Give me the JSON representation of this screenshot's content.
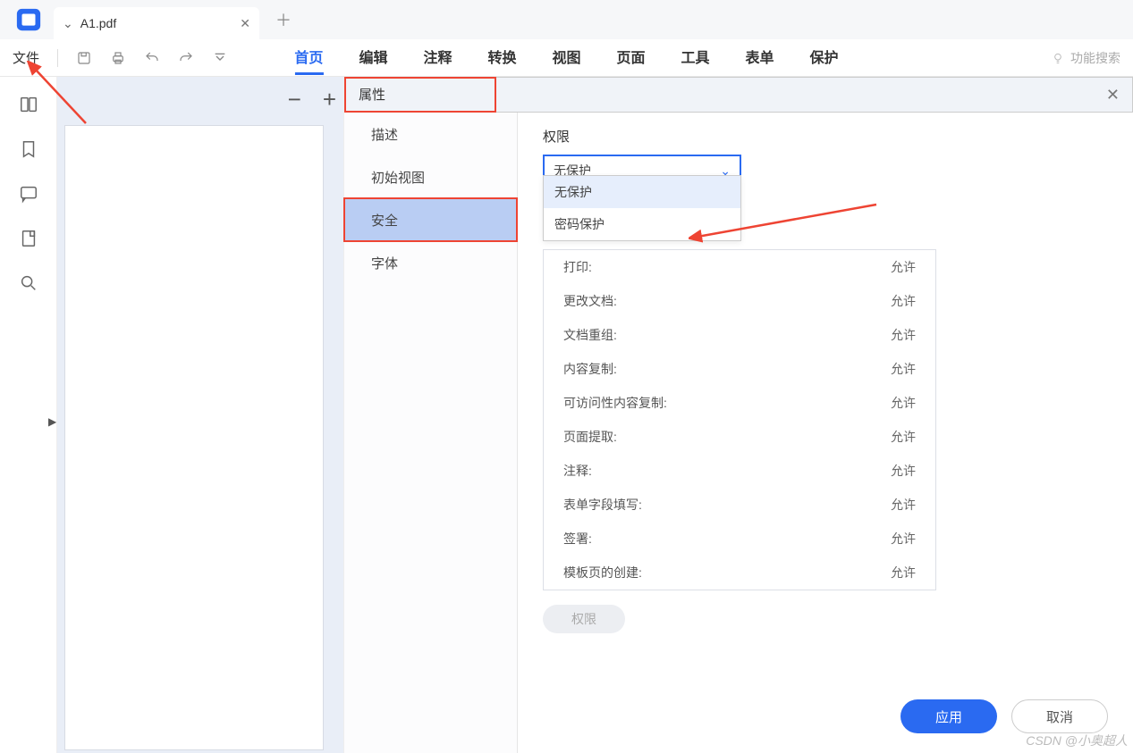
{
  "tab": {
    "filename": "A1.pdf"
  },
  "toolbar": {
    "file": "文件",
    "search_placeholder": "功能搜索"
  },
  "menu": [
    "首页",
    "编辑",
    "注释",
    "转换",
    "视图",
    "页面",
    "工具",
    "表单",
    "保护"
  ],
  "menu_active_index": 0,
  "panel": {
    "title": "属性",
    "nav": [
      "描述",
      "初始视图",
      "安全",
      "字体"
    ],
    "nav_active_index": 2,
    "section_label": "权限",
    "select_value": "无保护",
    "dropdown": [
      "无保护",
      "密码保护"
    ],
    "permissions": [
      {
        "k": "打印:",
        "v": "允许"
      },
      {
        "k": "更改文档:",
        "v": "允许"
      },
      {
        "k": "文档重组:",
        "v": "允许"
      },
      {
        "k": "内容复制:",
        "v": "允许"
      },
      {
        "k": "可访问性内容复制:",
        "v": "允许"
      },
      {
        "k": "页面提取:",
        "v": "允许"
      },
      {
        "k": "注释:",
        "v": "允许"
      },
      {
        "k": "表单字段填写:",
        "v": "允许"
      },
      {
        "k": "签署:",
        "v": "允许"
      },
      {
        "k": "模板页的创建:",
        "v": "允许"
      }
    ],
    "perm_btn": "权限",
    "apply": "应用",
    "cancel": "取消"
  },
  "watermark": "CSDN @小奥超人"
}
